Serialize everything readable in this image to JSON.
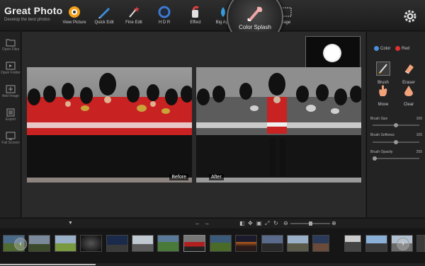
{
  "app": {
    "title": "Great Photo",
    "subtitle": "Develop the best photos"
  },
  "toolbar": {
    "items": [
      {
        "label": "View Picture",
        "icon": "eye-icon"
      },
      {
        "label": "Quick Edit",
        "icon": "pen-icon"
      },
      {
        "label": "Fine Edit",
        "icon": "wand-icon"
      },
      {
        "label": "H D R",
        "icon": "ring-icon"
      },
      {
        "label": "Effect",
        "icon": "effect-icon"
      },
      {
        "label": "Big Ape",
        "icon": "drop-icon"
      },
      {
        "label": "Color Splash",
        "icon": "splash-icon",
        "active": true
      },
      {
        "label": "llage",
        "icon": "collage-icon"
      }
    ],
    "settings_icon": "gear-icon"
  },
  "sidebar": {
    "items": [
      {
        "label": "Open Files",
        "icon": "folder-icon"
      },
      {
        "label": "Open Folder",
        "icon": "folder-open-icon"
      },
      {
        "label": "Add Image",
        "icon": "add-image-icon"
      },
      {
        "label": "Export",
        "icon": "export-icon"
      },
      {
        "label": "Full Screen",
        "icon": "fullscreen-icon"
      }
    ]
  },
  "preview": {
    "before_label": "Before",
    "after_label": "After"
  },
  "right_panel": {
    "mode_options": [
      {
        "label": "Color",
        "selected": false,
        "color": "#4a90d9"
      },
      {
        "label": "Red",
        "selected": true,
        "color": "#e03030"
      }
    ],
    "tools": [
      {
        "label": "Brush",
        "icon": "brush-icon"
      },
      {
        "label": "Eraser",
        "icon": "eraser-icon"
      },
      {
        "label": "Move",
        "icon": "hand-icon"
      },
      {
        "label": "Clear",
        "icon": "clear-icon"
      }
    ],
    "sliders": [
      {
        "label": "Brush Size",
        "value": "100",
        "fraction": 0.5
      },
      {
        "label": "Brush Softness",
        "value": "100",
        "fraction": 0.5
      },
      {
        "label": "Brush Opacity",
        "value": "255",
        "fraction": 0.0
      }
    ]
  },
  "controls": {
    "zoom_fraction": 0.5
  },
  "filmstrip": {
    "prev_icon": "chevron-left-icon",
    "next_icon": "chevron-right-icon",
    "scroll_fraction": 0.22
  }
}
